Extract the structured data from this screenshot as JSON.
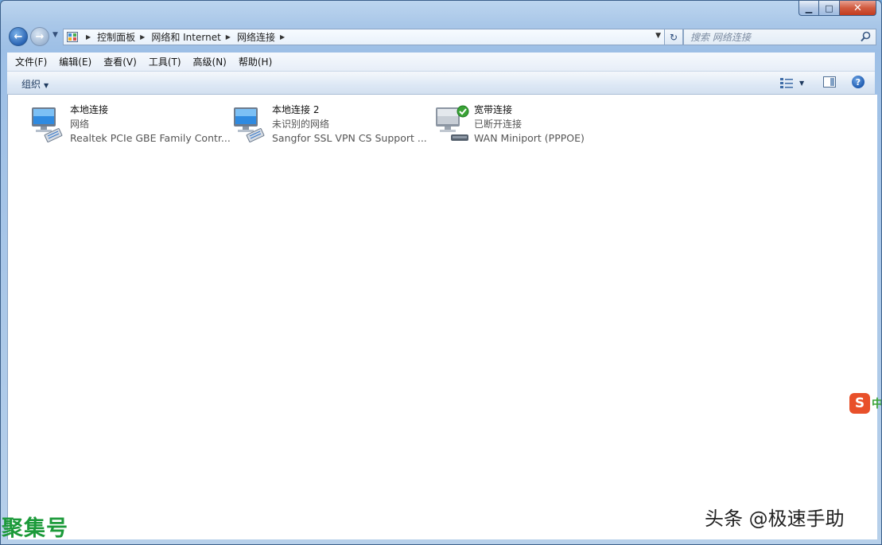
{
  "window": {
    "caption_buttons": {
      "minimize": "▁",
      "maximize": "□",
      "close": "✕"
    }
  },
  "nav": {
    "back_glyph": "←",
    "forward_glyph": "→",
    "dropdown_glyph": "▼",
    "breadcrumbs": [
      "控制面板",
      "网络和 Internet",
      "网络连接"
    ],
    "refresh_glyph": "↻",
    "search_placeholder": "搜索 网络连接"
  },
  "menubar": {
    "items": [
      "文件(F)",
      "编辑(E)",
      "查看(V)",
      "工具(T)",
      "高级(N)",
      "帮助(H)"
    ]
  },
  "cmdbar": {
    "organize_label": "组织",
    "help_glyph": "?"
  },
  "connections": [
    {
      "name": "本地连接",
      "status": "网络",
      "device": "Realtek PCIe GBE Family Contr...",
      "icon": "ethernet-adapter-icon"
    },
    {
      "name": "本地连接 2",
      "status": "未识别的网络",
      "device": "Sangfor SSL VPN CS Support ...",
      "icon": "ethernet-adapter-icon"
    },
    {
      "name": "宽带连接",
      "status": "已断开连接",
      "device": "WAN Miniport (PPPOE)",
      "icon": "broadband-modem-icon"
    }
  ],
  "overlays": {
    "ime_logo": "S",
    "ime_mode": "中",
    "watermark_left": "聚集号",
    "watermark_right": "头条 @极速手助"
  },
  "colors": {
    "accent": "#2a64b4",
    "title_bar": "#bcd5ef",
    "close_red": "#c23b1f",
    "ok_green": "#3aa335"
  }
}
